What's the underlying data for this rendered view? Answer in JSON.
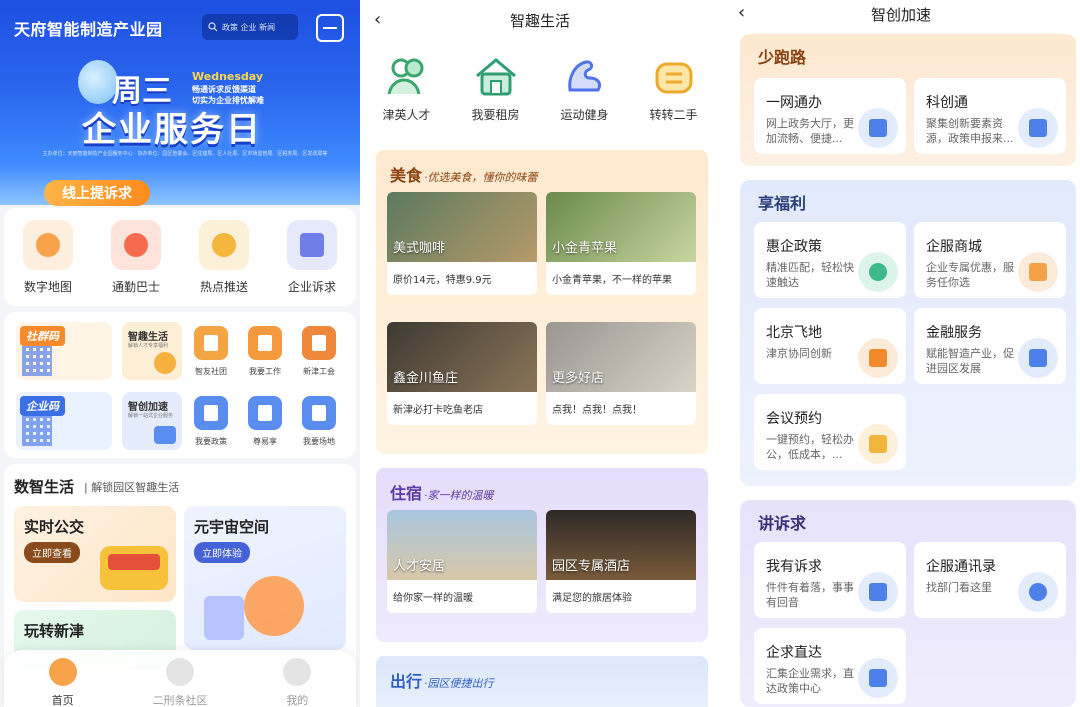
{
  "screen1": {
    "title": "天府智能制造产业园",
    "search_placeholder": "政策 企业 新闻",
    "banner": {
      "weekday": "周三",
      "weekday_en": "Wednesday",
      "line1": "畅通诉求反馈渠道",
      "line2": "切实为企业排忧解难",
      "slogan": "企业服务日",
      "fine_print": "主办单位：天府智能制造产业园服务中心 · 协办单位：园区管委会、区住建局、区人社局、区市场监管局、区税务局、区发改局等",
      "complain_button": "线上提诉求"
    },
    "main_icons": [
      {
        "label": "数字地图",
        "color": "#f7a34b"
      },
      {
        "label": "通勤巴士",
        "color": "#f46b4f"
      },
      {
        "label": "热点推送",
        "color": "#f5b63d"
      },
      {
        "label": "企业诉求",
        "color": "#6f7de8"
      }
    ],
    "codes": {
      "community": "社群码",
      "enterprise": "企业码",
      "fun_life": "智趣生活",
      "fun_life_desc": "解锁人才专享福利",
      "accel": "智创加速",
      "accel_desc": "解锁一站式企业服务"
    },
    "small_icons": [
      {
        "label": "智友社团",
        "color": "#f5a443"
      },
      {
        "label": "我要工作",
        "color": "#f39a3f"
      },
      {
        "label": "新津工会",
        "color": "#f0883b"
      },
      {
        "label": "我要政策",
        "color": "#5a8df0"
      },
      {
        "label": "尊易享",
        "color": "#5a8df0"
      },
      {
        "label": "我要场地",
        "color": "#5a8df0"
      }
    ],
    "life": {
      "heading": "数智生活",
      "subheading": "解锁园区智趣生活",
      "cards": [
        {
          "title": "实时公交",
          "button": "立即查看"
        },
        {
          "title": "元宇宙空间",
          "button": "立即体验"
        },
        {
          "title": "玩转新津",
          "button": ""
        }
      ]
    },
    "tabs": [
      {
        "label": "首页",
        "active": true
      },
      {
        "label": "二刑条社区",
        "active": false
      },
      {
        "label": "我的",
        "active": false
      }
    ]
  },
  "screen2": {
    "nav_title": "智趣生活",
    "back_icon": "‹",
    "icons": [
      {
        "label": "津英人才",
        "color": "#4cbf80"
      },
      {
        "label": "我要租房",
        "color": "#3fb98a"
      },
      {
        "label": "运动健身",
        "color": "#5e86f0"
      },
      {
        "label": "转转二手",
        "color": "#f2b63a"
      }
    ],
    "sections": [
      {
        "title": "美食",
        "subtitle": "·优选美食，懂你的味蕾",
        "cards": [
          {
            "name": "美式咖啡",
            "desc": "原价14元，特惠9.9元"
          },
          {
            "name": "小金青苹果",
            "desc": "小金青苹果，不一样的苹果"
          },
          {
            "name": "鑫金川鱼庄",
            "desc": "新津必打卡吃鱼老店"
          },
          {
            "name": "更多好店",
            "desc": "点我！点我！点我！"
          }
        ]
      },
      {
        "title": "住宿",
        "subtitle": "·家一样的温暖",
        "cards": [
          {
            "name": "人才安居",
            "desc": "给你家一样的温暖"
          },
          {
            "name": "园区专属酒店",
            "desc": "满足您的旅居体验"
          }
        ]
      },
      {
        "title": "出行",
        "subtitle": "·园区便捷出行",
        "cards": []
      }
    ]
  },
  "screen3": {
    "nav_title": "智创加速",
    "back_icon": "‹",
    "blocks": [
      {
        "title": "少跑路",
        "cards": [
          {
            "title": "一网通办",
            "desc": "网上政务大厅，更加流畅、便捷..."
          },
          {
            "title": "科创通",
            "desc": "聚集创新要素资源，政策申报来..."
          }
        ]
      },
      {
        "title": "享福利",
        "cards": [
          {
            "title": "惠企政策",
            "desc": "精准匹配，轻松快速触达"
          },
          {
            "title": "企服商城",
            "desc": "企业专属优惠，服务任你选"
          },
          {
            "title": "北京飞地",
            "desc": "津京协同创新"
          },
          {
            "title": "金融服务",
            "desc": "赋能智造产业，促进园区发展"
          },
          {
            "title": "会议预约",
            "desc": "一键预约，轻松办公，低成本，..."
          }
        ]
      },
      {
        "title": "讲诉求",
        "cards": [
          {
            "title": "我有诉求",
            "desc": "件件有着落，事事有回音"
          },
          {
            "title": "企服通讯录",
            "desc": "找部门看这里"
          },
          {
            "title": "企求直达",
            "desc": "汇集企业需求，直达政策中心"
          }
        ]
      }
    ]
  }
}
